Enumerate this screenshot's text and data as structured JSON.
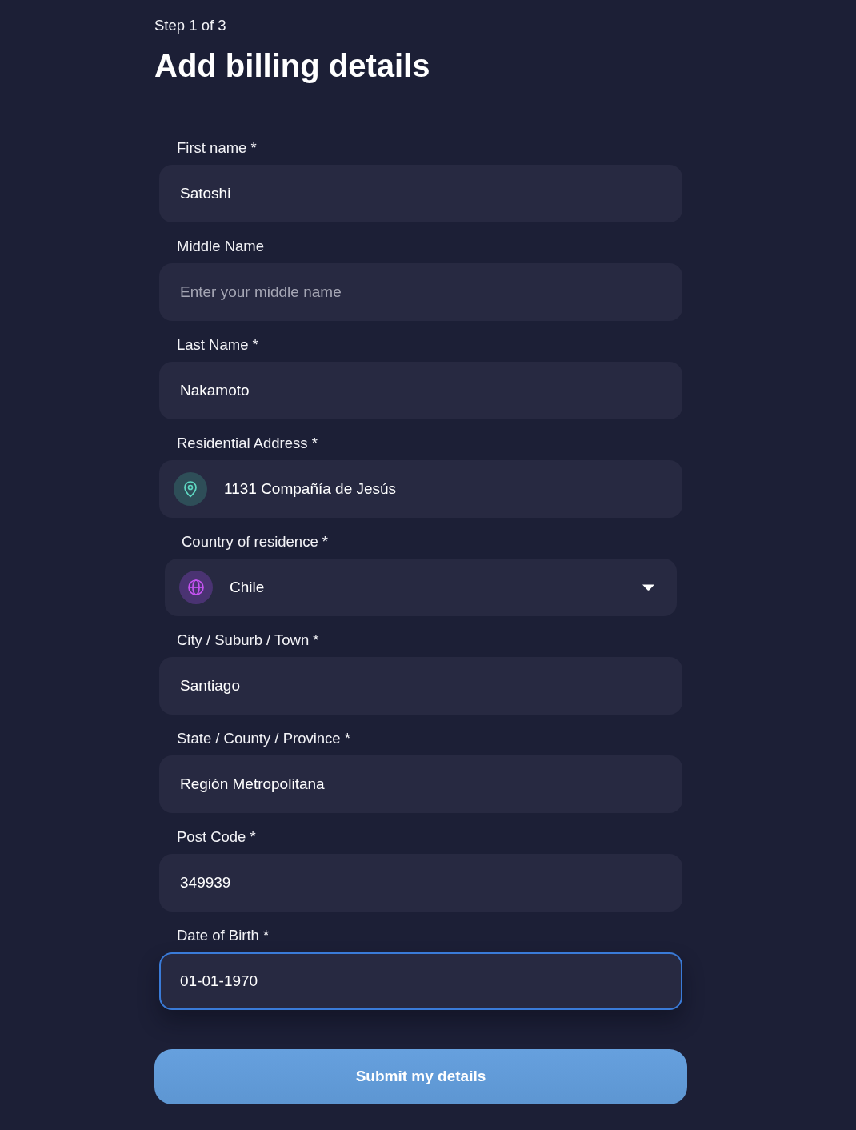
{
  "step": "Step 1 of 3",
  "title": "Add billing details",
  "fields": [
    {
      "kind": "text",
      "label": "First name *",
      "value": "Satoshi",
      "focused": false
    },
    {
      "kind": "text",
      "label": "Middle Name",
      "placeholder": "Enter your middle name",
      "focused": false
    },
    {
      "kind": "text",
      "label": "Last Name *",
      "value": "Nakamoto",
      "focused": false
    },
    {
      "kind": "address",
      "label": "Residential Address *",
      "value": "1131 Compañía de Jesús",
      "focused": false
    },
    {
      "kind": "select",
      "label": "Country of residence *",
      "value": "Chile",
      "focused": false
    },
    {
      "kind": "text",
      "label": "City / Suburb / Town *",
      "value": "Santiago",
      "focused": false
    },
    {
      "kind": "text",
      "label": "State / County / Province *",
      "value": "Región Metropolitana",
      "focused": false
    },
    {
      "kind": "text",
      "label": "Post Code *",
      "value": "349939",
      "focused": false
    },
    {
      "kind": "text",
      "label": "Date of Birth *",
      "value": "01-01-1970",
      "focused": true
    }
  ],
  "submit": {
    "label": "Submit my details"
  }
}
